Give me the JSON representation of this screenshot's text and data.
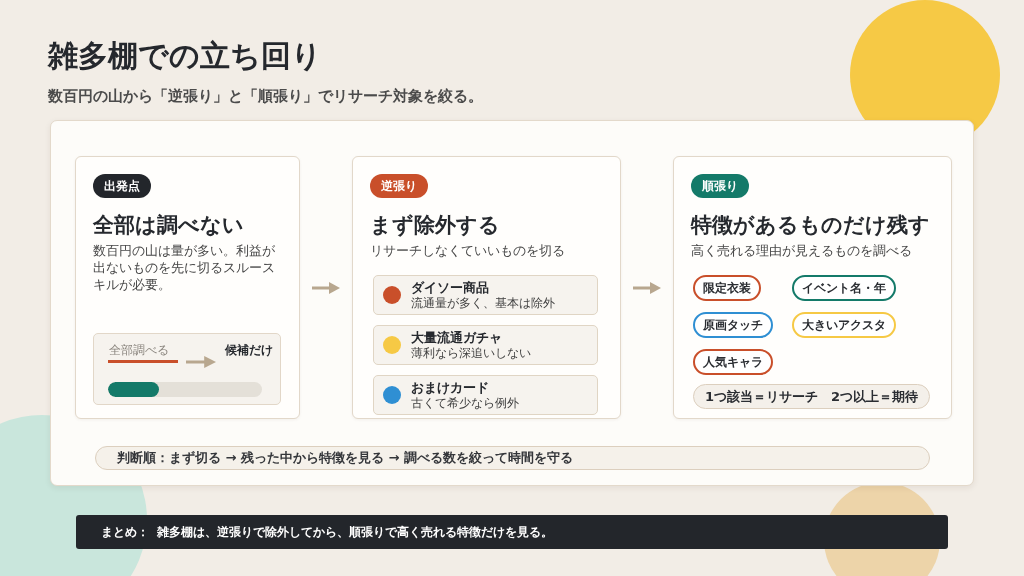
{
  "header": {
    "title": "雑多棚での立ち回り",
    "subtitle": "数百円の山から「逆張り」と「順張り」でリサーチ対象を絞る。"
  },
  "cards": [
    {
      "kind": "intro",
      "badge": {
        "label": "出発点",
        "color": "#23262b"
      },
      "title": "全部は調べない",
      "description": "数百円の山は量が多い。利益が出ないものを先に切るスルースキルが必要。",
      "comparison": {
        "before": "全部調べる",
        "after": "候補だけ",
        "level": 0.33
      }
    },
    {
      "kind": "exclude",
      "badge": {
        "label": "逆張り",
        "color": "#c94f2a"
      },
      "title": "まず除外する",
      "description": "リサーチしなくていいものを切る",
      "items": [
        {
          "name": "ダイソー商品",
          "note": "流通量が多く、基本は除外",
          "color": "#c94f2a"
        },
        {
          "name": "大量流通ガチャ",
          "note": "薄利なら深追いしない",
          "color": "#f6c945"
        },
        {
          "name": "おまけカード",
          "note": "古くて希少なら例外",
          "color": "#2f8fd3"
        }
      ]
    },
    {
      "kind": "keep",
      "badge": {
        "label": "順張り",
        "color": "#147a69"
      },
      "title": "特徴があるものだけ残す",
      "description": "高く売れる理由が見えるものを調べる",
      "tags": [
        {
          "label": "限定衣装",
          "color": "#c94f2a"
        },
        {
          "label": "イベント名・年",
          "color": "#147a69"
        },
        {
          "label": "原画タッチ",
          "color": "#2f8fd3"
        },
        {
          "label": "大きいアクスタ",
          "color": "#f6c945"
        },
        {
          "label": "人気キャラ",
          "color": "#c94f2a"
        }
      ],
      "rule": "1つ該当＝リサーチ　2つ以上＝期待"
    }
  ],
  "decision_order": "判断順：まず切る → 残った中から特徴を見る → 調べる数を絞って時間を守る",
  "summary": {
    "label": "まとめ：",
    "text": "雑多棚は、逆張りで除外してから、順張りで高く売れる特徴だけを見る。"
  }
}
